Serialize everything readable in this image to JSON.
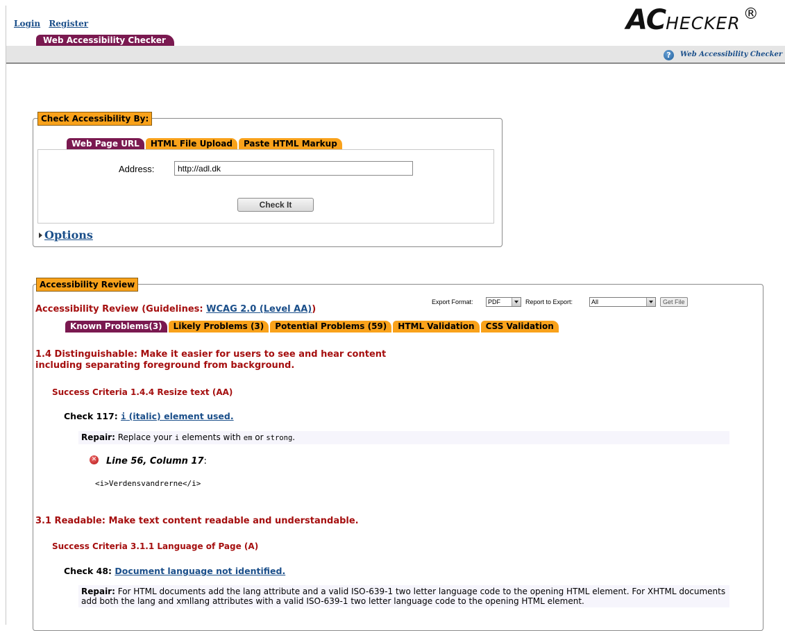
{
  "header": {
    "login_label": "Login",
    "register_label": "Register",
    "site_tab_label": "Web Accessibility Checker",
    "logo_ac": "AC",
    "logo_rest": "HECKER",
    "logo_reg": "®",
    "help_icon_glyph": "?",
    "help_link_label": "Web Accessibility Checker"
  },
  "check_panel": {
    "legend": "Check Accessibility By:",
    "tabs": [
      {
        "label": "Web Page URL",
        "active": true
      },
      {
        "label": "HTML File Upload",
        "active": false
      },
      {
        "label": "Paste HTML Markup",
        "active": false
      }
    ],
    "address_label": "Address:",
    "address_value": "http://adl.dk",
    "check_button_label": "Check It",
    "options_label": "Options"
  },
  "review_panel": {
    "legend": "Accessibility Review",
    "title_prefix": "Accessibility Review (Guidelines: ",
    "guideline_link": "WCAG 2.0 (Level AA)",
    "title_suffix": ")",
    "export_format_label": "Export Format:",
    "export_format_value": "PDF",
    "report_label": "Report to Export:",
    "report_value": "All",
    "get_file_label": "Get File",
    "tabs": [
      {
        "label": "Known Problems(3)",
        "active": true
      },
      {
        "label": "Likely Problems (3)",
        "active": false
      },
      {
        "label": "Potential Problems (59)",
        "active": false
      },
      {
        "label": "HTML Validation",
        "active": false
      },
      {
        "label": "CSS Validation",
        "active": false
      }
    ],
    "group1": {
      "heading_line1": "1.4 Distinguishable: Make it easier for users to see and hear content",
      "heading_line2": "including separating foreground from background.",
      "success_criteria": "Success Criteria 1.4.4 Resize text (AA)",
      "check_label": "Check 117:",
      "check_code": "i",
      "check_link_text": " (italic) element used.",
      "repair_label": "Repair:",
      "repair_text1": " Replace your ",
      "repair_code1": "i",
      "repair_text2": " elements with ",
      "repair_code2": "em",
      "repair_text3": " or ",
      "repair_code3": "strong",
      "repair_text4": ".",
      "error_icon_glyph": "✕",
      "line_info": "Line 56, Column 17",
      "line_info_colon": ":",
      "code_snippet": "<i>Verdensvandrerne</i>"
    },
    "group2": {
      "heading": "3.1 Readable: Make text content readable and understandable.",
      "success_criteria": "Success Criteria 3.1.1 Language of Page (A)",
      "check_label": "Check 48:",
      "check_link_text": "Document language not identified.",
      "repair_label": "Repair:",
      "repair_text": " For HTML documents add the lang attribute and a valid ISO-639-1 two letter language code to the opening HTML element. For XHTML documents add both the lang and xmllang attributes with a valid ISO-639-1 two letter language code to the opening HTML element."
    }
  }
}
